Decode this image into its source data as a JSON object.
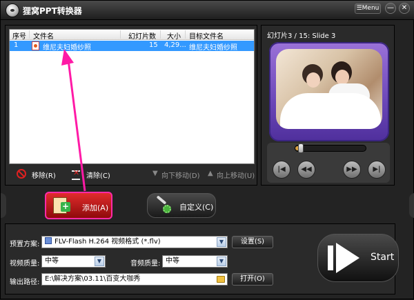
{
  "window": {
    "title": "狸窝PPT转换器",
    "menu_label": "Menu",
    "minimize_glyph": "—",
    "close_glyph": "✕"
  },
  "file_list": {
    "columns": [
      "序号",
      "文件名",
      "幻灯片数",
      "大小",
      "目标文件名"
    ],
    "rows": [
      {
        "index": "1",
        "filename": "维尼夫妇婚纱照",
        "slides": "15",
        "size": "4,29...",
        "target": "维尼夫妇婚纱照",
        "selected": true
      }
    ]
  },
  "list_actions": {
    "remove": "移除(R)",
    "clear": "清除(C)",
    "move_down": "向下移动(D)",
    "move_up": "向上移动(U)"
  },
  "preview": {
    "label": "幻灯片3 / 15: Slide 3",
    "seek_progress": 0.08
  },
  "player_buttons": [
    "|◀",
    "◀◀",
    "▶▶",
    "▶|"
  ],
  "buttons": {
    "add": "添加(A)",
    "custom": "自定义(C)",
    "start": "Start",
    "settings": "设置(S)",
    "open": "打开(O)"
  },
  "settings": {
    "preset_label": "预置方案:",
    "preset_value": "FLV-Flash H.264 视频格式 (*.flv)",
    "video_quality_label": "视频质量:",
    "video_quality_value": "中等",
    "audio_quality_label": "音频质量:",
    "audio_quality_value": "中等",
    "output_path_label": "输出路径:",
    "output_path_value": "E:\\解决方案\\03.11\\百变大咖秀"
  },
  "colors": {
    "selection": "#3399ff",
    "annotation_arrow": "#ff1aa6",
    "add_button": "#c81e1e"
  }
}
